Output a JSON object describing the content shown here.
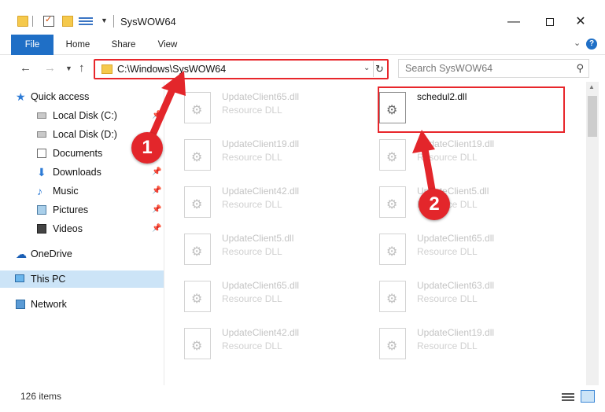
{
  "window": {
    "title": "SysWOW64",
    "minimize_glyph": "—",
    "close_glyph": "✕"
  },
  "ribbon": {
    "tabs": [
      "File",
      "Home",
      "Share",
      "View"
    ],
    "help_glyph": "?"
  },
  "navigation": {
    "address": "C:\\Windows\\SysWOW64",
    "search_placeholder": "Search SysWOW64"
  },
  "sidebar": {
    "items": [
      {
        "label": "Quick access",
        "icon": "star-icon",
        "pinned": false
      },
      {
        "label": "Local Disk (C:)",
        "icon": "disk-icon",
        "pinned": true
      },
      {
        "label": "Local Disk (D:)",
        "icon": "disk-icon",
        "pinned": false
      },
      {
        "label": "Documents",
        "icon": "documents-icon",
        "pinned": true
      },
      {
        "label": "Downloads",
        "icon": "download-icon",
        "pinned": true
      },
      {
        "label": "Music",
        "icon": "music-icon",
        "pinned": true
      },
      {
        "label": "Pictures",
        "icon": "pictures-icon",
        "pinned": true
      },
      {
        "label": "Videos",
        "icon": "videos-icon",
        "pinned": true
      },
      {
        "label": "OneDrive",
        "icon": "cloud-icon",
        "pinned": false
      },
      {
        "label": "This PC",
        "icon": "computer-icon",
        "pinned": false,
        "selected": true
      },
      {
        "label": "Network",
        "icon": "network-icon",
        "pinned": false
      }
    ]
  },
  "files": {
    "column1": [
      {
        "name": "UpdateClient65.dll",
        "type": "Resource DLL"
      },
      {
        "name": "UpdateClient19.dll",
        "type": "Resource DLL"
      },
      {
        "name": "UpdateClient42.dll",
        "type": "Resource DLL"
      },
      {
        "name": "UpdateClient5.dll",
        "type": "Resource DLL"
      },
      {
        "name": "UpdateClient65.dll",
        "type": "Resource DLL"
      },
      {
        "name": "UpdateClient42.dll",
        "type": "Resource DLL"
      }
    ],
    "column2": [
      {
        "name": "schedul2.dll",
        "type": "",
        "highlighted": true
      },
      {
        "name": "UpdateClient19.dll",
        "type": "Resource DLL"
      },
      {
        "name": "UpdateClient5.dll",
        "type": "Resource DLL"
      },
      {
        "name": "UpdateClient65.dll",
        "type": "Resource DLL"
      },
      {
        "name": "UpdateClient63.dll",
        "type": "Resource DLL"
      },
      {
        "name": "UpdateClient19.dll",
        "type": "Resource DLL"
      }
    ]
  },
  "status": {
    "item_count": "126 items"
  },
  "annotations": {
    "badge1": "1",
    "badge2": "2",
    "color": "#e3262b"
  }
}
